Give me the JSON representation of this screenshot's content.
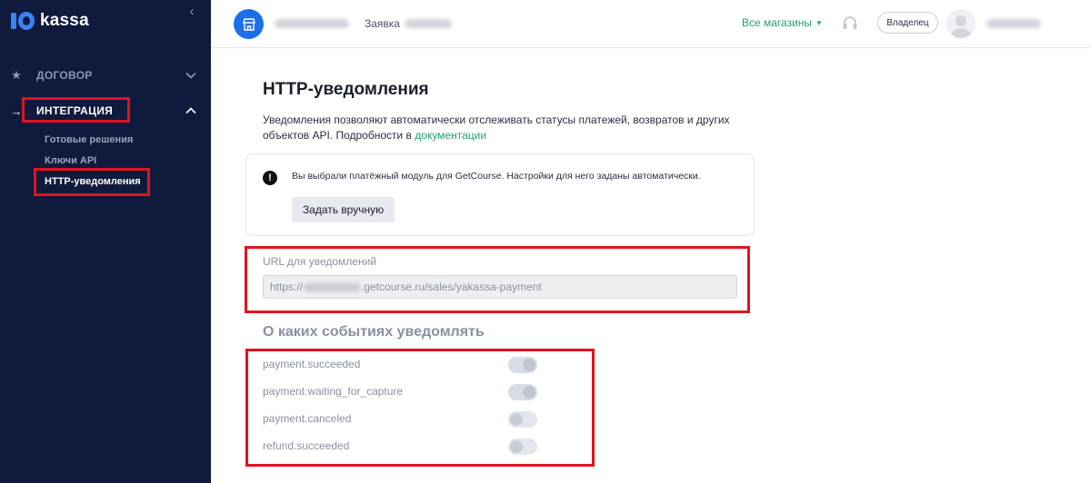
{
  "brand": {
    "logo_text": "kassa"
  },
  "sidebar": {
    "items": [
      {
        "label": "ДОГОВОР",
        "icon": "star-icon",
        "expanded": false
      },
      {
        "label": "ИНТЕГРАЦИЯ",
        "icon": "arrow-right-icon",
        "expanded": true,
        "children": [
          {
            "label": "Готовые решения"
          },
          {
            "label": "Ключи API"
          },
          {
            "label": "HTTP-уведомления",
            "active": true
          }
        ]
      }
    ]
  },
  "header": {
    "request_label": "Заявка",
    "stores_dropdown": "Все магазины",
    "role_badge": "Владелец"
  },
  "main": {
    "title": "HTTP-уведомления",
    "intro_text": "Уведомления позволяют автоматически отслеживать статусы платежей, возвратов и других объектов API. Подробности в ",
    "intro_link": "документации",
    "notice": {
      "text": "Вы выбрали платёжный модуль для GetCourse. Настройки для него заданы автоматически.",
      "button": "Задать вручную"
    },
    "url_field": {
      "label": "URL для уведомлений",
      "value_prefix": "https://",
      "value_suffix": ".getcourse.ru/sales/yakassa-payment"
    },
    "events_title": "О каких событиях уведомлять",
    "events": [
      {
        "name": "payment.succeeded",
        "enabled": true
      },
      {
        "name": "payment.waiting_for_capture",
        "enabled": true
      },
      {
        "name": "payment.canceled",
        "enabled": false
      },
      {
        "name": "refund.succeeded",
        "enabled": false
      }
    ]
  },
  "colors": {
    "sidebar_bg": "#0f1a3c",
    "accent_green": "#23a26d",
    "brand_blue": "#1c6fe8",
    "highlight_red": "#e0141e"
  }
}
